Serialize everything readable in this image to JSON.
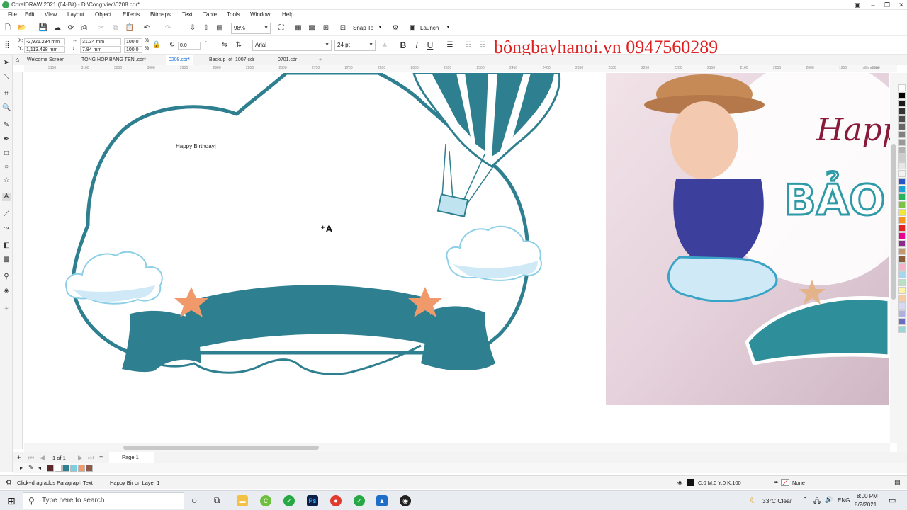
{
  "window": {
    "title": "CorelDRAW 2021 (64-Bit) - D:\\Cong viec\\0208.cdr*"
  },
  "menu": [
    "File",
    "Edit",
    "View",
    "Layout",
    "Object",
    "Effects",
    "Bitmaps",
    "Text",
    "Table",
    "Tools",
    "Window",
    "Help"
  ],
  "toolbar": {
    "zoom": "98%",
    "snap_label": "Snap To",
    "launch_label": "Launch"
  },
  "propbar": {
    "x": "-2,921.234 mm",
    "y": "1,113.498 mm",
    "w": "31.34 mm",
    "h": "7.84 mm",
    "scale_x": "100.0",
    "scale_y": "100.0",
    "pct": "%",
    "rotation": "0.0",
    "font": "Arial",
    "size": "24 pt",
    "bold": "B",
    "italic": "I",
    "underline": "U"
  },
  "tabs": [
    {
      "label": "Welcome Screen",
      "active": false
    },
    {
      "label": "TONG HOP BANG TEN .cdr*",
      "active": false
    },
    {
      "label": "0208.cdr*",
      "active": true
    },
    {
      "label": "Backup_of_1007.cdr",
      "active": false
    },
    {
      "label": "0701.cdr",
      "active": false
    }
  ],
  "ruler": {
    "units": "millimeters",
    "top_ticks": [
      "3150",
      "3100",
      "3050",
      "3000",
      "2950",
      "2900",
      "2850",
      "2800",
      "2750",
      "2700",
      "2650",
      "2600",
      "2550",
      "2500",
      "2450",
      "2400",
      "2350",
      "2300",
      "2250",
      "2200",
      "2150",
      "2100",
      "2050",
      "2000",
      "1950",
      "1900"
    ]
  },
  "canvas": {
    "text_object": "Happy Birthday|",
    "photo_text_1": "Happ",
    "photo_text_2": "BẢO"
  },
  "watermark": "bôngbayhanoi.vn 0947560289",
  "pagenav": {
    "count": "1 of 1",
    "page_label": "Page 1"
  },
  "status": {
    "hint": "Click+drag adds Paragraph Text",
    "object_info": "Happy Bir on Layer 1",
    "fill_info": "C:0 M:0 Y:0 K:100",
    "outline_info": "None"
  },
  "taskbar": {
    "search_placeholder": "Type here to search",
    "weather": "33°C  Clear",
    "lang": "ENG",
    "time": "8:00 PM",
    "date": "8/2/2021"
  },
  "colors": {
    "teal": "#2e7f8f",
    "cloud_blue": "#cfeaf6",
    "star": "#f09a6b",
    "watermark_red": "#e02020"
  },
  "palette_colors": [
    "#ffffff",
    "#000000",
    "#1a1a1a",
    "#333333",
    "#4d4d4d",
    "#666666",
    "#808080",
    "#999999",
    "#b3b3b3",
    "#cccccc",
    "#e6e6e6",
    "#f2f2f2",
    "#2a55c8",
    "#1fa0d8",
    "#25b35b",
    "#7dc242",
    "#f2e63a",
    "#f7941d",
    "#e52421",
    "#ec008c",
    "#8b2d8c",
    "#c3986b",
    "#8b5e3c",
    "#f6b3c7",
    "#a6d6ee",
    "#b7e1c0",
    "#fff3a6",
    "#f9c9a0",
    "#d9d9f3",
    "#b0b0e0",
    "#6c6cc0",
    "#9bd6d6"
  ],
  "doc_palette": [
    "#5a2a2a",
    "#ffffff",
    "#2e7f8f",
    "#7ccfe0",
    "#f09a6b",
    "#8b5a4a"
  ]
}
